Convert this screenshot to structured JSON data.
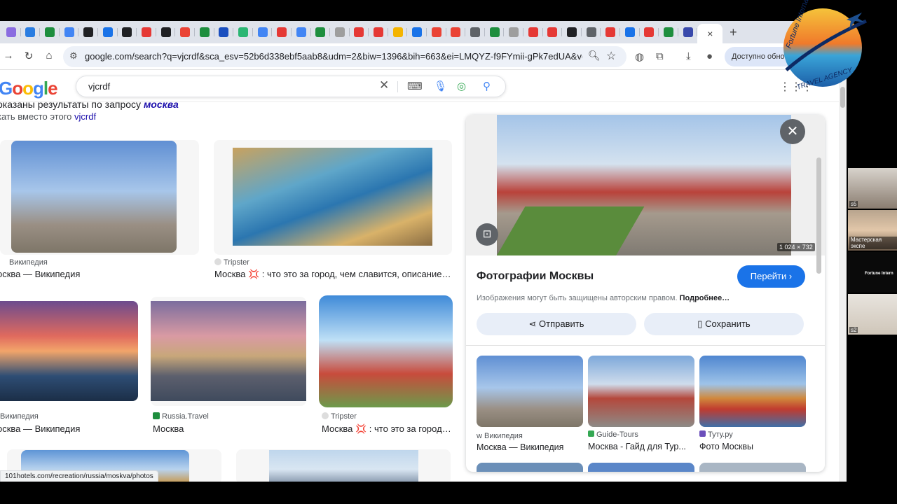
{
  "browser": {
    "tab_favicon_colors": [
      "#8a6ce0",
      "#2a7de1",
      "#1e8e3e",
      "#4285f4",
      "#202124",
      "#1a73e8",
      "#202124",
      "#e53935",
      "#202124",
      "#ea4335",
      "#1e8e3e",
      "#1a4fbf",
      "#2bb673",
      "#4285f4",
      "#e53935",
      "#4285f4",
      "#1e8e3e",
      "#9e9e9e",
      "#e53935",
      "#e53935",
      "#f4b400",
      "#1a73e8",
      "#ea4335",
      "#ea4335",
      "#5f6368",
      "#1e8e3e",
      "#9e9e9e",
      "#e53935",
      "#e53935",
      "#202124",
      "#5f6368",
      "#e53935",
      "#1a73e8",
      "#e53935",
      "#1e8e3e",
      "#3949ab"
    ],
    "active_tab_close": "×",
    "new_tab": "+",
    "url": "google.com/search?q=vjcrdf&sca_esv=52b6d338ebf5aab8&udm=2&biw=1396&bih=663&ei=LMQYZ-f9FYmii-gPk7edUA&ved=0ahUKEwjn...",
    "profile_chip": "Доступно обно..."
  },
  "search": {
    "logo": "Google",
    "query": "vjcrdf",
    "notice_prefix": "оказаны результаты по запросу",
    "notice_query": "москва",
    "notice_alt_prefix": "кать вместо этого",
    "notice_alt_query": "vjcrdf"
  },
  "results": [
    {
      "source": "Википедия",
      "title": "осква — Википедия"
    },
    {
      "source": "Tripster",
      "title": "Москва 💢 : что это за город, чем славится, описание ..."
    },
    {
      "source": "Википедия",
      "title": "осква — Википедия"
    },
    {
      "source": "Russia.Travel",
      "title": "Москва"
    },
    {
      "source": "Tripster",
      "title": "Москва 💢 : что это за город,..."
    }
  ],
  "panel": {
    "dimensions": "1 024 × 732",
    "title": "Фотографии Москвы",
    "visit_label": "Перейти",
    "copyright_text": "Изображения могут быть защищены авторским правом.",
    "copyright_more": "Подробнее…",
    "share_label": "Отправить",
    "save_label": "Сохранить",
    "related": [
      {
        "source": "Википедия",
        "title": "Москва — Википедия"
      },
      {
        "source": "Guide-Tours",
        "title": "Москва - Гайд для Тур..."
      },
      {
        "source": "Туту.ру",
        "title": "Фото Москвы"
      }
    ]
  },
  "status_url": "101hotels.com/recreation/russia/moskva/photos",
  "overlay": {
    "logo_text_top": "Fortune International",
    "logo_text_bottom": "TRAVEL AGENCY",
    "participants": [
      {
        "label": "s5"
      },
      {
        "label": "Мастерская экспе"
      },
      {
        "label": "Fortune Intern"
      },
      {
        "label": "s2"
      }
    ]
  }
}
